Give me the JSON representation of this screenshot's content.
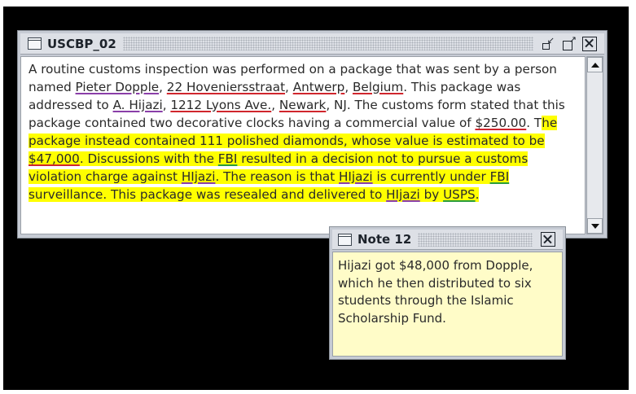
{
  "document_window": {
    "title": "USCBP_02",
    "text": {
      "seg1": "A routine customs inspection was performed on a package that was sent by a person named ",
      "person1": "Pieter Dopple",
      "sep1": ", ",
      "street1": "22 Hoveniersstraat",
      "sep2": ", ",
      "city1": "Antwerp",
      "sep3": ", ",
      "country1": "Belgium",
      "seg2": ". This package was addressed to ",
      "person2": "A. Hijazi",
      "sep4": ", ",
      "street2": "1212 Lyons Ave.",
      "sep5": ", ",
      "city2": "Newark",
      "seg3": ", NJ. The customs form stated that this package contained two decorative clocks having a commercial value of ",
      "money1": "$250.00",
      "seg4": ". T",
      "hl1": "he package instead contained 111 polished diamonds, whose value is estimated to be ",
      "money2": "$47,000",
      "hl2": ". Discussions with the ",
      "org1": "FBI",
      "hl3": " resulted in a decision not to pursue a customs violation charge against ",
      "person3": "HIjazi",
      "hl4": ". The reason is that ",
      "person4": "HIjazi",
      "hl5": " is currently under ",
      "org2": "FBI",
      "hl6": " surveillance. This package was resealed and delivered to ",
      "person5": "HIjazi",
      "hl7": " by ",
      "org3": "USPS",
      "hl8": "."
    }
  },
  "note_window": {
    "title": "Note 12",
    "text": "Hijazi got $48,000 from Dopple, which he then distributed to six students through the Islamic Scholarship Fund."
  },
  "icons": {
    "window_icon": "window-icon",
    "iconify": "iconify-icon",
    "maximize": "maximize-icon",
    "close": "close-icon",
    "scroll_up": "arrow-up-icon",
    "scroll_down": "arrow-down-icon"
  },
  "colors": {
    "highlight": "#ffff00",
    "person_underline": "#8a3fa8",
    "place_underline": "#d0262d",
    "org_underline": "#2a9d3a",
    "note_background": "#fffcc8"
  }
}
